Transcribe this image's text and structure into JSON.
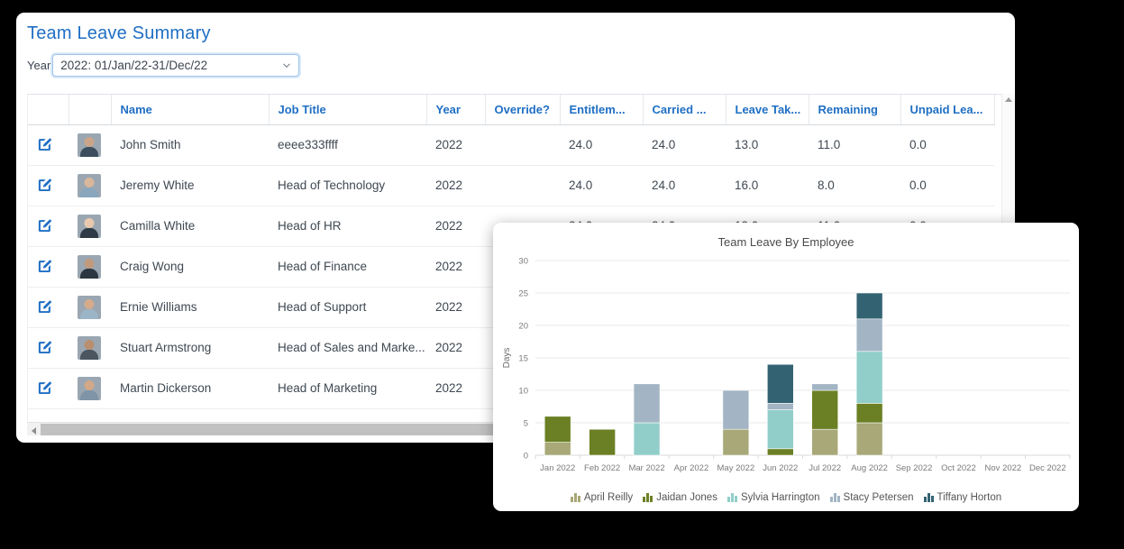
{
  "card": {
    "title": "Team Leave Summary",
    "year_label": "Year",
    "year_value": "2022: 01/Jan/22-31/Dec/22",
    "caret_icon": "chevron-down-icon"
  },
  "table": {
    "columns": [
      {
        "key": "edit",
        "label": ""
      },
      {
        "key": "avatar",
        "label": ""
      },
      {
        "key": "name",
        "label": "Name"
      },
      {
        "key": "job",
        "label": "Job Title"
      },
      {
        "key": "year",
        "label": "Year"
      },
      {
        "key": "override",
        "label": "Override?"
      },
      {
        "key": "entitlement",
        "label": "Entitlem..."
      },
      {
        "key": "carried",
        "label": "Carried ..."
      },
      {
        "key": "taken",
        "label": "Leave Tak..."
      },
      {
        "key": "remaining",
        "label": "Remaining"
      },
      {
        "key": "unpaid",
        "label": "Unpaid Lea..."
      }
    ],
    "rows": [
      {
        "edit": "edit-icon",
        "avatar_head": "#caa58a",
        "avatar_body": "#3d4f5e",
        "name": "John Smith",
        "job": "eeee333ffff",
        "year": "2022",
        "override": "",
        "entitlement": "24.0",
        "carried": "24.0",
        "taken": "13.0",
        "remaining": "11.0",
        "unpaid": "0.0"
      },
      {
        "edit": "edit-icon",
        "avatar_head": "#d9b79a",
        "avatar_body": "#8aa6bd",
        "name": "Jeremy White",
        "job": "Head of Technology",
        "year": "2022",
        "override": "",
        "entitlement": "24.0",
        "carried": "24.0",
        "taken": "16.0",
        "remaining": "8.0",
        "unpaid": "0.0"
      },
      {
        "edit": "edit-icon",
        "avatar_head": "#e8c9ad",
        "avatar_body": "#2e3a45",
        "name": "Camilla White",
        "job": "Head of HR",
        "year": "2022",
        "override": "",
        "entitlement": "24.0",
        "carried": "24.0",
        "taken": "13.0",
        "remaining": "11.0",
        "unpaid": "0.0"
      },
      {
        "edit": "edit-icon",
        "avatar_head": "#c09a7d",
        "avatar_body": "#2b3640",
        "name": "Craig Wong",
        "job": "Head of Finance",
        "year": "2022",
        "override": "",
        "entitlement": "",
        "carried": "",
        "taken": "",
        "remaining": "",
        "unpaid": ""
      },
      {
        "edit": "edit-icon",
        "avatar_head": "#d6ab8b",
        "avatar_body": "#9cb5c6",
        "name": "Ernie Williams",
        "job": "Head of Support",
        "year": "2022",
        "override": "",
        "entitlement": "",
        "carried": "",
        "taken": "",
        "remaining": "",
        "unpaid": ""
      },
      {
        "edit": "edit-icon",
        "avatar_head": "#b98f6f",
        "avatar_body": "#4a5560",
        "name": "Stuart Armstrong",
        "job": "Head of Sales and Marke...",
        "year": "2022",
        "override": "",
        "entitlement": "",
        "carried": "",
        "taken": "",
        "remaining": "",
        "unpaid": ""
      },
      {
        "edit": "edit-icon",
        "avatar_head": "#d2a888",
        "avatar_body": "#7f94a6",
        "name": "Martin Dickerson",
        "job": "Head of Marketing",
        "year": "2022",
        "override": "",
        "entitlement": "",
        "carried": "",
        "taken": "",
        "remaining": "",
        "unpaid": ""
      }
    ],
    "vscroll_arrow_icon": "scroll-up-arrow-icon",
    "hscroll_arrow_icon": "scroll-left-arrow-icon"
  },
  "chart_data": {
    "type": "bar",
    "stacked": true,
    "title": "Team Leave By Employee",
    "xlabel": "",
    "ylabel": "Days",
    "ylim": [
      0,
      30
    ],
    "yticks": [
      0,
      5,
      10,
      15,
      20,
      25,
      30
    ],
    "grid": true,
    "legend_position": "bottom",
    "legend_marker_icon": "bar-chart-icon",
    "categories": [
      "Jan 2022",
      "Feb 2022",
      "Mar 2022",
      "Apr 2022",
      "May 2022",
      "Jun 2022",
      "Jul 2022",
      "Aug 2022",
      "Sep 2022",
      "Oct 2022",
      "Nov 2022",
      "Dec 2022"
    ],
    "series": [
      {
        "name": "April Reilly",
        "color": "#a8a878",
        "values": [
          2,
          0,
          0,
          0,
          4,
          0,
          4,
          5,
          0,
          0,
          0,
          0
        ]
      },
      {
        "name": "Jaidan Jones",
        "color": "#6b8024",
        "values": [
          4,
          4,
          0,
          0,
          0,
          1,
          6,
          3,
          0,
          0,
          0,
          0
        ]
      },
      {
        "name": "Sylvia Harrington",
        "color": "#91ceca",
        "values": [
          0,
          0,
          5,
          0,
          0,
          6,
          0,
          8,
          0,
          0,
          0,
          0
        ]
      },
      {
        "name": "Stacy Petersen",
        "color": "#a3b5c4",
        "values": [
          0,
          0,
          6,
          0,
          6,
          1,
          1,
          5,
          0,
          0,
          0,
          0
        ]
      },
      {
        "name": "Tiffany Horton",
        "color": "#336373",
        "values": [
          0,
          0,
          0,
          0,
          0,
          6,
          0,
          4,
          0,
          0,
          0,
          0
        ]
      }
    ],
    "totals": [
      6,
      4,
      11,
      0,
      10,
      14,
      11,
      25,
      0,
      0,
      0,
      0
    ]
  }
}
